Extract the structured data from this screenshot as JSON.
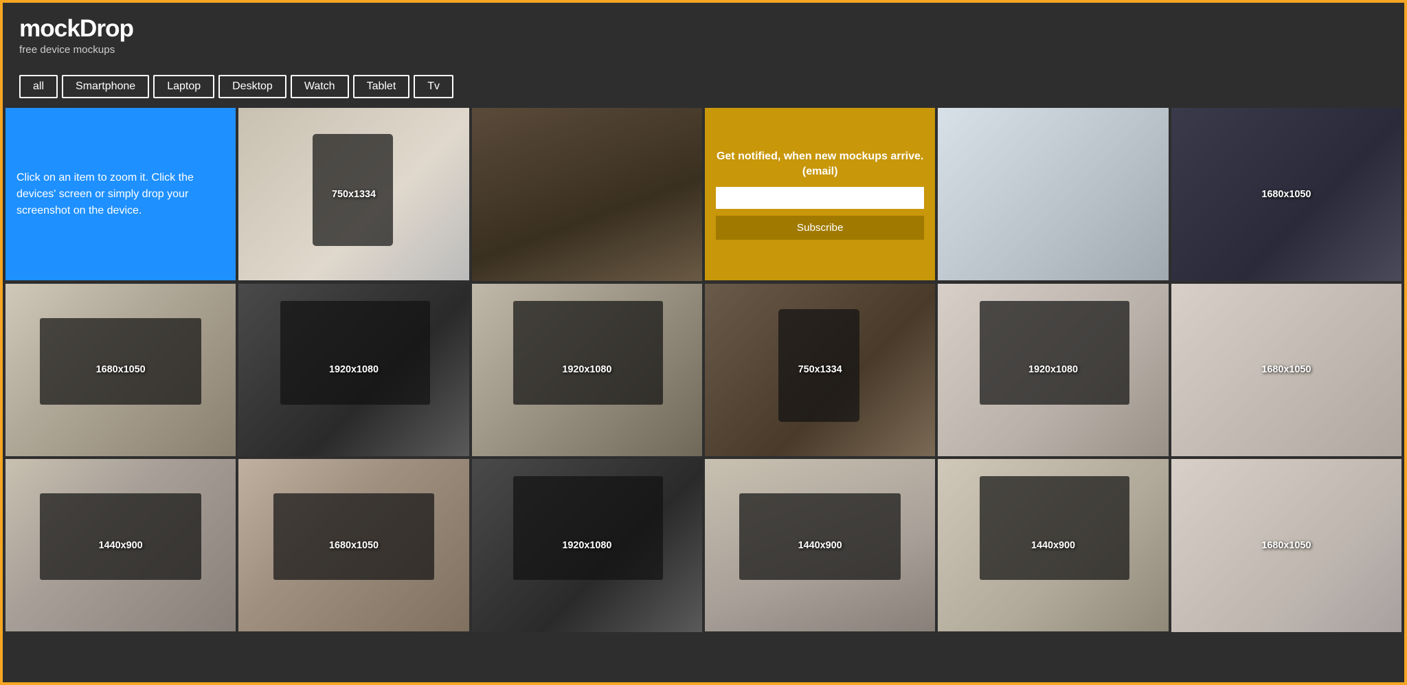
{
  "header": {
    "title": "mockDrop",
    "subtitle": "free device mockups"
  },
  "filters": {
    "items": [
      "all",
      "Smartphone",
      "Laptop",
      "Desktop",
      "Watch",
      "Tablet",
      "Tv"
    ]
  },
  "info_box": {
    "text": "Click on an item to zoom it. Click the devices' screen or simply drop your screenshot on the device."
  },
  "notify_box": {
    "label": "Get notified, when new mockups arrive. (email)",
    "placeholder": "",
    "button_label": "Subscribe"
  },
  "grid_items": [
    {
      "id": 1,
      "type": "mockup",
      "bg": "bg-hand-phone",
      "label": "750x1334",
      "device": "phone"
    },
    {
      "id": 2,
      "type": "mockup",
      "bg": "bg-desk-dark",
      "label": "",
      "device": "scene"
    },
    {
      "id": 3,
      "type": "mockup",
      "bg": "bg-person-vr",
      "label": "",
      "device": "scene"
    },
    {
      "id": 4,
      "type": "mockup",
      "bg": "bg-phone-cables",
      "label": "1680x1050",
      "device": "scene"
    },
    {
      "id": 5,
      "type": "mockup",
      "bg": "bg-laptop-desk",
      "label": "1680x1050",
      "device": "laptop"
    },
    {
      "id": 6,
      "type": "mockup",
      "bg": "bg-monitor-dark",
      "label": "1920x1080",
      "device": "monitor"
    },
    {
      "id": 7,
      "type": "mockup",
      "bg": "bg-monitor-desk",
      "label": "1920x1080",
      "device": "monitor"
    },
    {
      "id": 8,
      "type": "mockup",
      "bg": "bg-phone-coffee",
      "label": "750x1334",
      "device": "phone"
    },
    {
      "id": 9,
      "type": "mockup",
      "bg": "bg-imac-books",
      "label": "1920x1080",
      "device": "monitor"
    },
    {
      "id": 10,
      "type": "mockup",
      "bg": "bg-man-phone",
      "label": "1680x1050",
      "device": "scene"
    },
    {
      "id": 11,
      "type": "mockup",
      "bg": "bg-laptop-notebook",
      "label": "1440x900",
      "device": "laptop"
    },
    {
      "id": 12,
      "type": "mockup",
      "bg": "bg-laptop-couch",
      "label": "1680x1050",
      "device": "laptop"
    },
    {
      "id": 13,
      "type": "mockup",
      "bg": "bg-imac-large",
      "label": "1920x1080",
      "device": "monitor"
    },
    {
      "id": 14,
      "type": "mockup",
      "bg": "bg-desk-laptop",
      "label": "1440x900",
      "device": "laptop"
    },
    {
      "id": 15,
      "type": "mockup",
      "bg": "bg-imac-office",
      "label": "1440x900",
      "device": "monitor"
    },
    {
      "id": 16,
      "type": "mockup",
      "bg": "bg-man-laptop",
      "label": "1680x1050",
      "device": "scene"
    }
  ]
}
